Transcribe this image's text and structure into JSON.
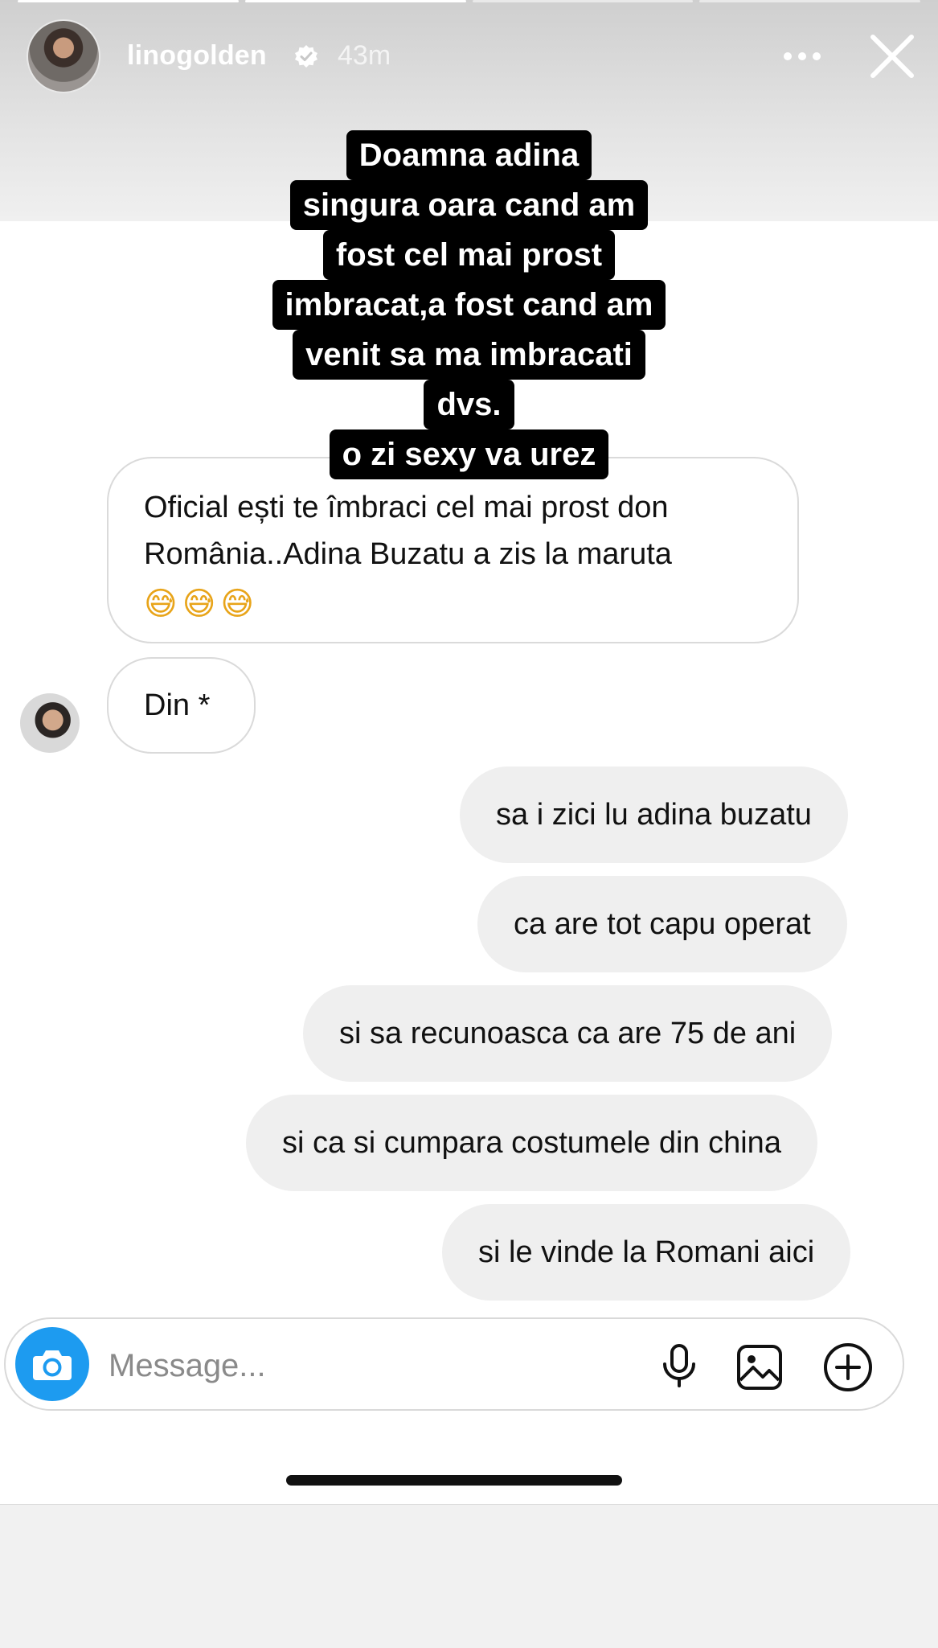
{
  "story": {
    "username": "linogolden",
    "time_ago": "43m",
    "progress_segments": [
      1,
      1,
      0.35,
      0
    ]
  },
  "caption": {
    "lines": [
      "Doamna adina",
      "singura oara cand am",
      "fost cel mai prost",
      "imbracat,a fost cand am",
      "venit sa ma imbracati",
      "dvs.",
      "o zi sexy va urez"
    ]
  },
  "messages": {
    "received": [
      {
        "text": "Oficial ești te îmbraci cel mai prost don România..Adina Buzatu a zis la maruta",
        "emojis": "😅😅😅"
      },
      {
        "text": "Din *"
      }
    ],
    "sent": [
      {
        "text": "sa i zici lu adina buzatu"
      },
      {
        "text": "ca are tot capu operat"
      },
      {
        "text": "si sa recunoasca ca are 75 de ani"
      },
      {
        "text": "si ca si cumpara costumele din china"
      },
      {
        "text": "si le vinde la Romani aici"
      }
    ]
  },
  "composer": {
    "placeholder": "Message..."
  },
  "colors": {
    "camera_button": "#1d9bf0",
    "sent_bubble": "#efefef",
    "caption_background": "#000000"
  },
  "icons": [
    "verified-badge-icon",
    "more-icon",
    "close-icon",
    "camera-icon",
    "microphone-icon",
    "image-icon",
    "plus-icon"
  ]
}
